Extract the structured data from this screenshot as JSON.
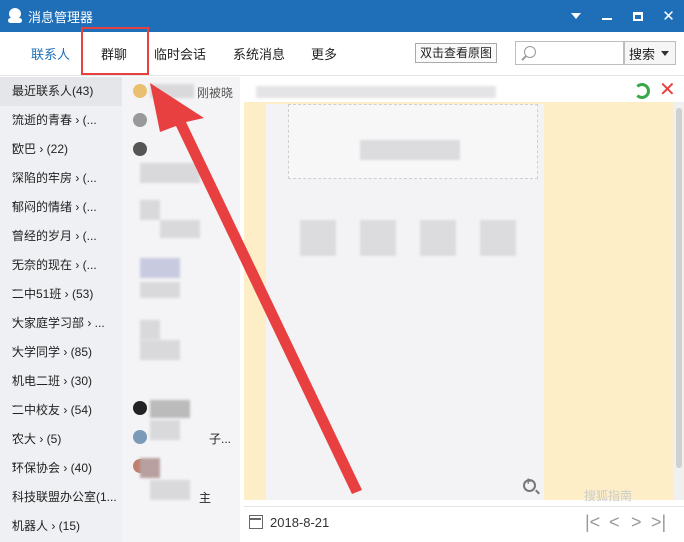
{
  "window": {
    "title": "消息管理器",
    "controls": [
      "menu-arrow",
      "minimize",
      "maximize",
      "close"
    ]
  },
  "tabs": [
    {
      "label": "联系人",
      "active": true
    },
    {
      "label": "群聊",
      "active": false,
      "highlighted": true
    },
    {
      "label": "临时会话",
      "active": false
    },
    {
      "label": "系统消息",
      "active": false
    },
    {
      "label": "更多",
      "active": false
    }
  ],
  "toolbar": {
    "hint_button": "双击查看原图",
    "search_placeholder": "",
    "search_button": "搜索"
  },
  "groups": [
    {
      "label": "最近联系人(43)"
    },
    {
      "label": "流逝的青春 › (..."
    },
    {
      "label": "欧巴 › (22)"
    },
    {
      "label": "深陷的牢房 › (..."
    },
    {
      "label": "郁闷的情绪 › (..."
    },
    {
      "label": "曾经的岁月 › (..."
    },
    {
      "label": "无奈的现在 › (..."
    },
    {
      "label": "二中51班 › (53)"
    },
    {
      "label": "大家庭学习部 › ..."
    },
    {
      "label": "大学同学 › (85)"
    },
    {
      "label": "机电二班 › (30)"
    },
    {
      "label": "二中校友 › (54)"
    },
    {
      "label": "农大 › (5)"
    },
    {
      "label": "环保协会 › (40)"
    },
    {
      "label": "科技联盟办公室(1..."
    },
    {
      "label": "机器人 › (15)"
    }
  ],
  "midlist": {
    "row_text_1": "刚被晓",
    "row_text_13": "子...",
    "row_text_15": "主"
  },
  "message_pane": {
    "date": "2018-8-21"
  },
  "watermark": "搜狐指南",
  "colors": {
    "titlebar": "#1f6fb8",
    "accent": "#1f6fb8",
    "highlight": "#e84040",
    "pane_bg": "#fdeec7"
  }
}
